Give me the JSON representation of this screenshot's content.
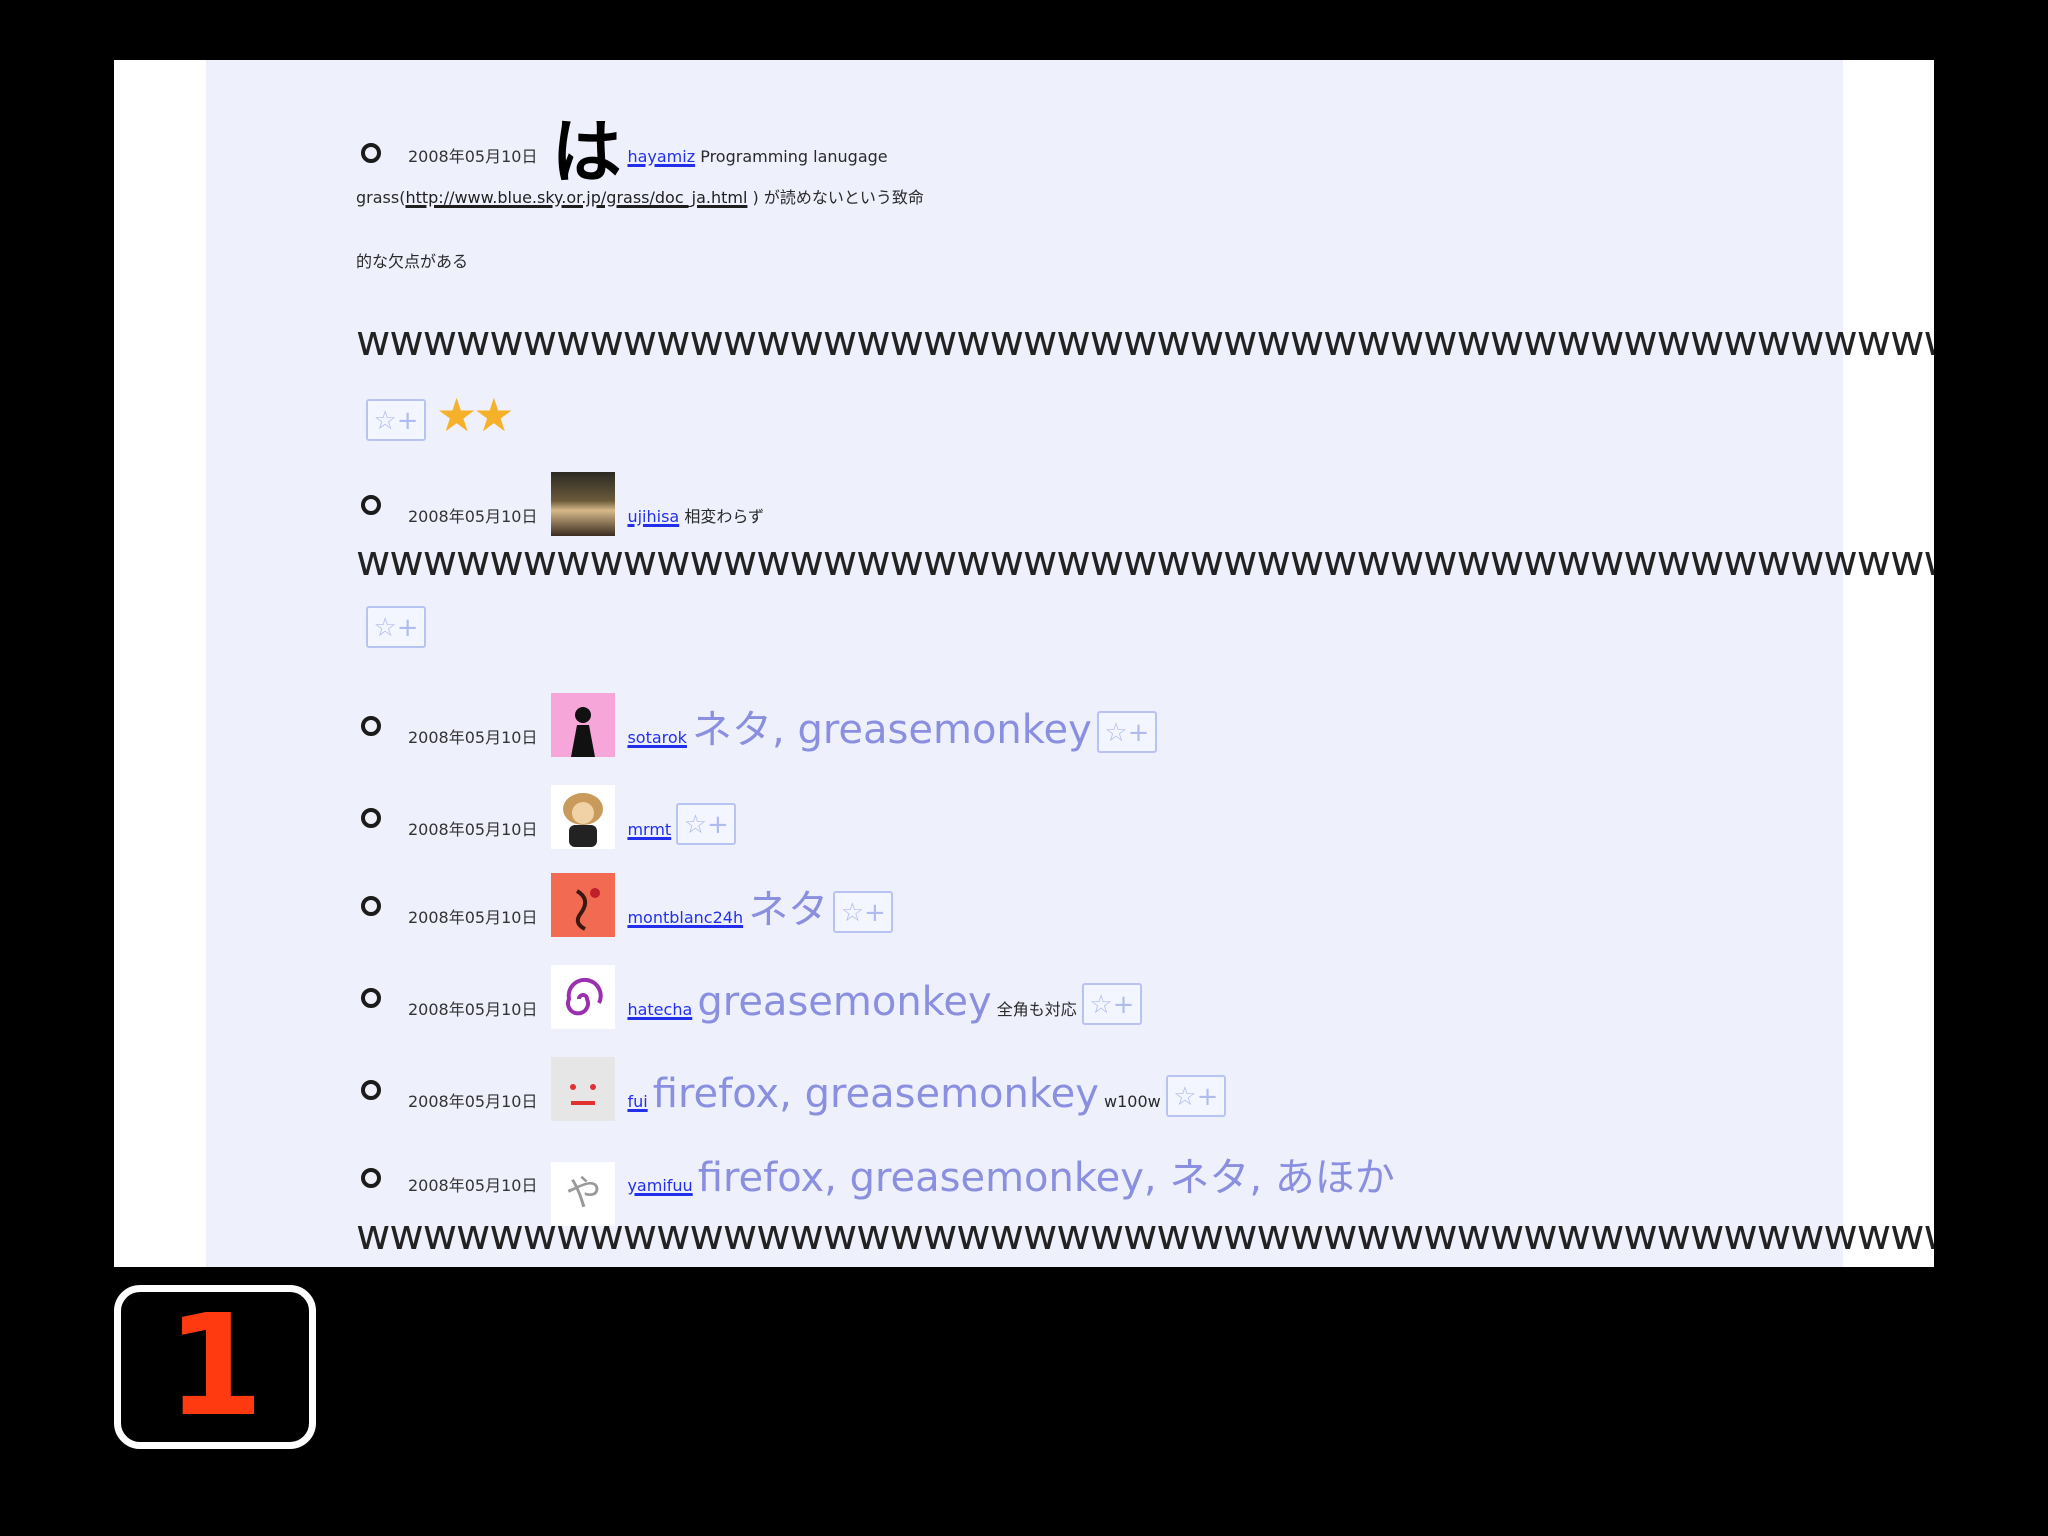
{
  "entries": [
    {
      "date": "2008年05月10日",
      "avatar_icon": "hatena-ha-icon",
      "user": "hayamiz",
      "comment_pre": "Programming lanugage",
      "comment_mid": "grass(",
      "link": "http://www.blue.sky.or.jp/grass/doc_ja.html",
      "comment_post": " ) が読めないという致命",
      "comment_line3": "的な欠点がある",
      "w_line": "wwwwwwwwwwwwwwwwwwwwwwwwwwwwwwwwwwwwwwwwwwwwwwwwwwww",
      "add_star": "☆+",
      "stars": "★★"
    },
    {
      "date": "2008年05月10日",
      "avatar_icon": "ujihisa-avatar-icon",
      "user": "ujihisa",
      "comment": "相変わらず",
      "w_line": "wwwwwwwwwwwwwwwwwwwwwwwwwwwwwwwwwwwwwwwwwwwwwwwwwwww",
      "add_star": "☆+"
    },
    {
      "date": "2008年05月10日",
      "avatar_icon": "sotarok-avatar-icon",
      "user": "sotarok",
      "tags": "ネタ, greasemonkey",
      "add_star": "☆+"
    },
    {
      "date": "2008年05月10日",
      "avatar_icon": "mrmt-avatar-icon",
      "user": "mrmt",
      "add_star": "☆+"
    },
    {
      "date": "2008年05月10日",
      "avatar_icon": "montblanc24h-avatar-icon",
      "user": "montblanc24h",
      "tags": "ネタ",
      "add_star": "☆+"
    },
    {
      "date": "2008年05月10日",
      "avatar_icon": "hatecha-avatar-icon",
      "user": "hatecha",
      "tags": "greasemonkey",
      "comment": "全角も対応",
      "add_star": "☆+"
    },
    {
      "date": "2008年05月10日",
      "avatar_icon": "fui-avatar-icon",
      "user": "fui",
      "tags": "firefox, greasemonkey",
      "comment": "w100w",
      "add_star": "☆+"
    },
    {
      "date": "2008年05月10日",
      "avatar_icon": "yamifuu-avatar-icon",
      "avatar_char": "や",
      "user": "yamifuu",
      "tags": "firefox, greasemonkey, ネタ, あほか",
      "w_line": "wwwwwwwwwwwwwwwwwwwwwwwwwwwwwwwwwwwwwwwwwwwwwwwwwwww",
      "add_star": "☆+",
      "stars": "★★"
    }
  ],
  "hatena_char": "は",
  "slide_number": "1",
  "colors": {
    "background": "#000000",
    "panel": "#eef0fc",
    "link": "#2230ee",
    "tags": "#8a8fdf",
    "star": "#f6b12b",
    "slide_number": "#ff3a10"
  }
}
